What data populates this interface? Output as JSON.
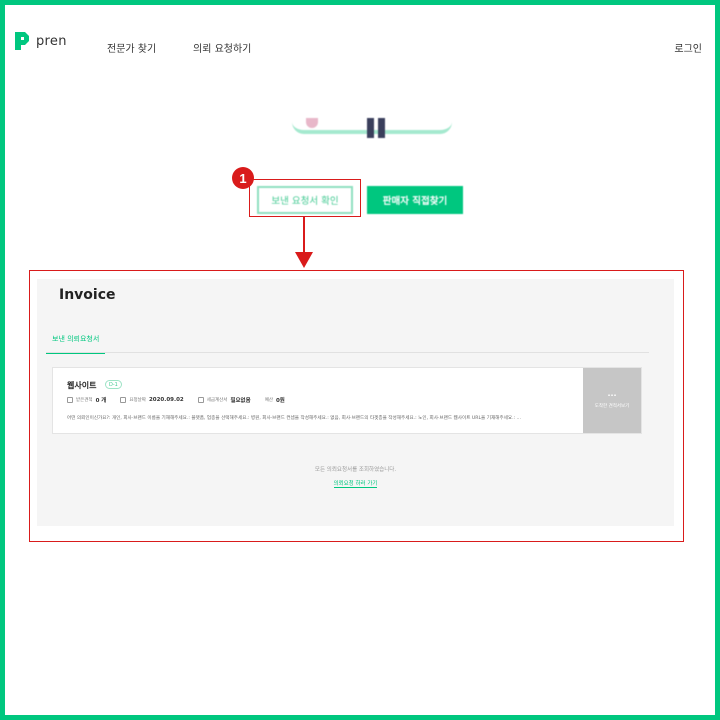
{
  "header": {
    "logo_text": "pren",
    "nav": {
      "find_experts": "전문가 찾기",
      "request_work": "의뢰 요청하기"
    },
    "login": "로그인"
  },
  "hero": {
    "step_number": "1",
    "sent_requests_button": "보낸 요청서 확인",
    "find_seller_button": "판매자 직접찾기"
  },
  "invoice": {
    "title": "Invoice",
    "tab_sent": "보낸 의뢰요청서",
    "card": {
      "title": "웹사이트",
      "badge": "D-1",
      "received_label": "받은견적",
      "received_value": "0 개",
      "request_date_label": "요청날짜",
      "request_date_value": "2020.09.02",
      "tax_invoice_label": "세금계산서",
      "tax_invoice_value": "필요없음",
      "budget_label": "예산",
      "budget_value": "0원",
      "description": "어떤 의뢰인이신가요?: 개인, 회사·브랜드 이름을 기재해주세요.: 플랫폼, 업종을 선택해주세요.: 병원, 회사·브랜드 컨셉을 작성해주세요.: 없음, 회사·브랜드의 타겟층을 작성해주세요.: 노인, 회사·브랜드 웹사이트 URL을 기재해주세요.: ...",
      "side_label": "도착한 견적서보기"
    },
    "empty_message": "모든 의뢰요청서를 조회하였습니다.",
    "go_request_link": "의뢰요청 하러 가기"
  },
  "colors": {
    "brand": "#00c77f",
    "annotation": "#d91b1b"
  }
}
